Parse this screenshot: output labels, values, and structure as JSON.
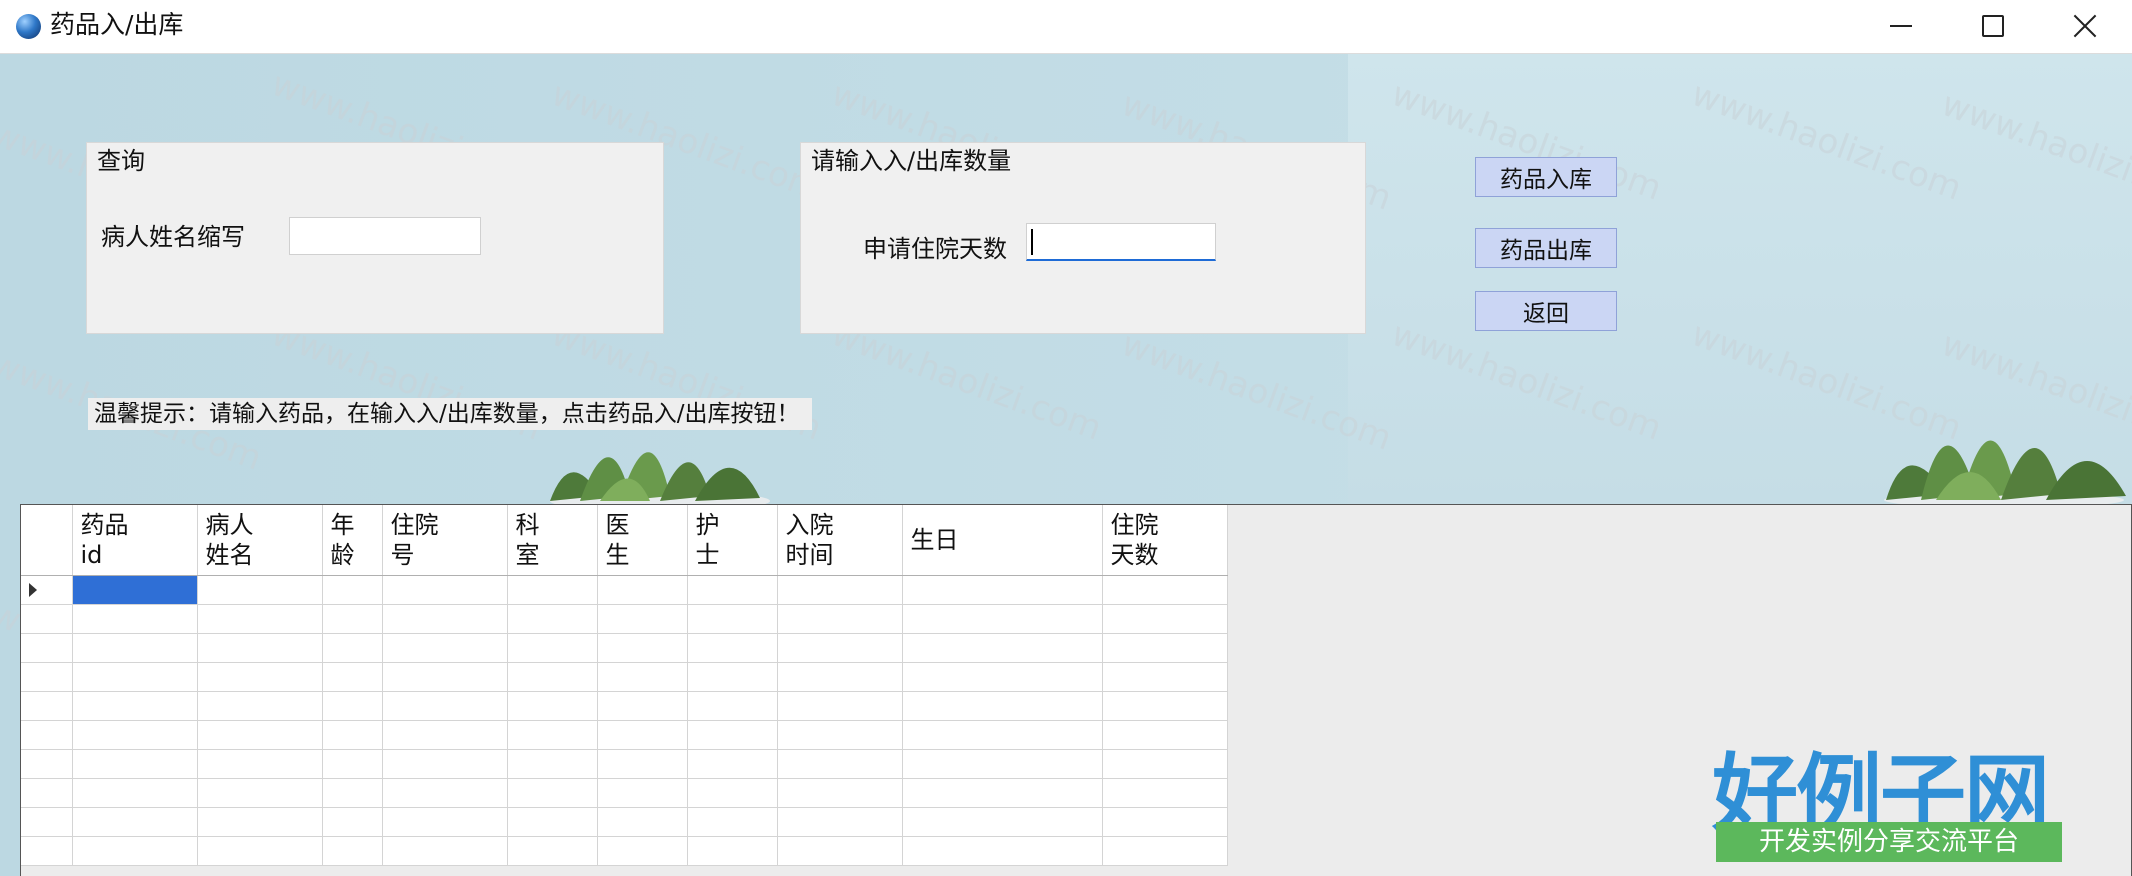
{
  "window": {
    "title": "药品入/出库"
  },
  "query_group": {
    "title": "查询",
    "name_label": "病人姓名缩写",
    "name_value": ""
  },
  "qty_group": {
    "title": "请输入入/出库数量",
    "days_label": "申请住院天数",
    "days_value": ""
  },
  "buttons": {
    "stock_in": "药品入库",
    "stock_out": "药品出库",
    "back": "返回"
  },
  "tip": "温馨提示：请输入药品，在输入入/出库数量，点击药品入/出库按钮！",
  "grid": {
    "columns": [
      [
        "药品",
        "id"
      ],
      [
        "病人",
        "姓名"
      ],
      [
        "年",
        "龄"
      ],
      [
        "住院",
        "号"
      ],
      [
        "科",
        "室"
      ],
      [
        "医",
        "生"
      ],
      [
        "护",
        "士"
      ],
      [
        "入院",
        "时间"
      ],
      [
        "生日",
        ""
      ],
      [
        "住院",
        "天数"
      ]
    ],
    "empty_rows": 9
  },
  "watermark": "www.haolizi.com",
  "logo": {
    "main": "好例子网",
    "sub": "开发实例分享交流平台"
  },
  "colors": {
    "accent": "#2f6fd6",
    "button": "#cbd6f4",
    "logo_blue": "#2f8fd6",
    "logo_green": "#5cb85c"
  }
}
